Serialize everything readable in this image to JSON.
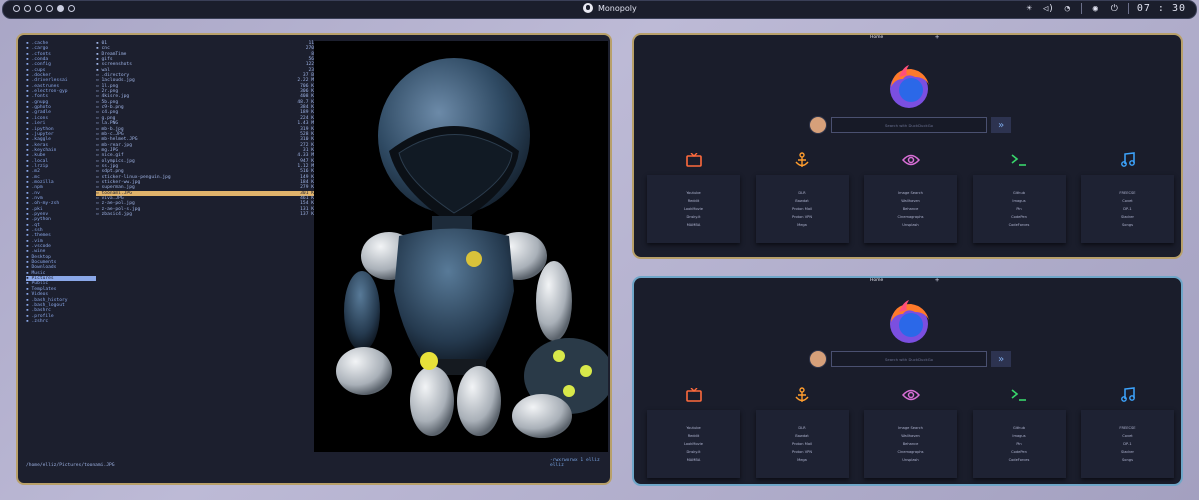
{
  "topbar": {
    "title": "Monopoly",
    "clock": "07 : 30",
    "workspaces": [
      false,
      false,
      false,
      false,
      true,
      false
    ],
    "icons": [
      "brightness-icon",
      "volume-icon",
      "wifi-icon",
      "record-icon",
      "power-icon"
    ]
  },
  "files": {
    "col_a": [
      ".cache",
      ".cargo",
      ".cfonts",
      ".conda",
      ".config",
      ".cups",
      ".docker",
      ".driverlessai",
      ".eastrunes",
      ".electron-gyp",
      ".fonts",
      ".gnupg",
      ".gphoto",
      ".gradle",
      ".icons",
      ".ieri",
      ".ipython",
      ".jupyter",
      ".kaggle",
      ".keras",
      ".keychain",
      ".kube",
      ".local",
      ".lrzip",
      ".m2",
      ".mc",
      ".mozilla",
      ".npm",
      ".nv",
      ".nvm",
      ".oh-my-zsh",
      ".pki",
      ".pyenv",
      ".python",
      ".qt",
      ".ssh",
      ".themes",
      ".vim",
      ".vscode",
      ".wine",
      "Desktop",
      "Documents",
      "Downloads",
      "Music",
      "Pictures",
      "Public",
      "Templates",
      "Videos",
      ".bash_history",
      ".bash_logout",
      ".bashrc",
      ".profile",
      ".zshrc"
    ],
    "col_a_selected": 44,
    "col_b": [
      {
        "n": "01",
        "s": "11"
      },
      {
        "n": "cnc",
        "s": "270"
      },
      {
        "n": "DreamTime",
        "s": "8"
      },
      {
        "n": "gifs",
        "s": "56"
      },
      {
        "n": "screenshots",
        "s": "122"
      },
      {
        "n": "wal",
        "s": "23"
      },
      {
        "n": ".directory",
        "s": "37 B"
      },
      {
        "n": "1aclouds.jpg",
        "s": "2.22 M"
      },
      {
        "n": "1l.png",
        "s": "706 K"
      },
      {
        "n": "2r.png",
        "s": "306 K"
      },
      {
        "n": "4kisre.jpg",
        "s": "408 K"
      },
      {
        "n": "5b.png",
        "s": "48.7 K"
      },
      {
        "n": "c9-b.png",
        "s": "384 K"
      },
      {
        "n": "c4.png",
        "s": "189 K"
      },
      {
        "n": "g.png",
        "s": "224 K"
      },
      {
        "n": "la.PNG",
        "s": "1.43 M"
      },
      {
        "n": "mb-b.jpg",
        "s": "319 K"
      },
      {
        "n": "mb-c.JPG",
        "s": "528 K"
      },
      {
        "n": "mb-helmet.JPG",
        "s": "310 K"
      },
      {
        "n": "mb-rear.jpg",
        "s": "272 K"
      },
      {
        "n": "mg.JPG",
        "s": "31 K"
      },
      {
        "n": "nice.gif",
        "s": "4.33 M"
      },
      {
        "n": "olympics.jpg",
        "s": "947 K"
      },
      {
        "n": "ss.jpg",
        "s": "1.12 M"
      },
      {
        "n": "sdpt.png",
        "s": "516 K"
      },
      {
        "n": "sticker-linux-penguin.jpg",
        "s": "149 K"
      },
      {
        "n": "sticker-ww.jpg",
        "s": "184 K"
      },
      {
        "n": "superman.jpg",
        "s": "279 K"
      },
      {
        "n": "toonami.JPG",
        "s": "301 K"
      },
      {
        "n": "viva.JPG",
        "s": "461 K"
      },
      {
        "n": "z-ae-pol.jpg",
        "s": "154 K"
      },
      {
        "n": "z-ae-pol-s.jpg",
        "s": "131 K"
      },
      {
        "n": "zbasic4.jpg",
        "s": "137 K"
      }
    ],
    "col_b_selected": 28,
    "status_left": "/home/elliz/Pictures/toonami.JPG",
    "status_right": "-rwxrwxrwx 1 elliz elliz"
  },
  "browser": {
    "tab": "Home",
    "search_placeholder": "Search with DuckDuckGo",
    "search_go": "»",
    "categories": [
      {
        "icon": "tv-icon",
        "color": "#ff6b3d",
        "links": [
          "Youtube",
          "Reddit",
          "LookMovie",
          "Dnsky.it",
          "MAMBA"
        ]
      },
      {
        "icon": "anchor-icon",
        "color": "#ff9d2e",
        "links": [
          "DLR",
          "Bawdat",
          "Proton Mail",
          "Proton VPN",
          "Mega"
        ]
      },
      {
        "icon": "eye-icon",
        "color": "#d96fd6",
        "links": [
          "Image Search",
          "Wallhaven",
          "Behance",
          "Cinemagraphs",
          "Unsplash"
        ]
      },
      {
        "icon": "terminal-icon",
        "color": "#38d66b",
        "links": [
          "Github",
          "Imagus",
          "Pin",
          "CodePen",
          "CodeForces"
        ]
      },
      {
        "icon": "music-icon",
        "color": "#3da5ff",
        "links": [
          "FREECSE",
          "Covet",
          "DP-1",
          "Slacker",
          "Songs"
        ]
      }
    ]
  }
}
